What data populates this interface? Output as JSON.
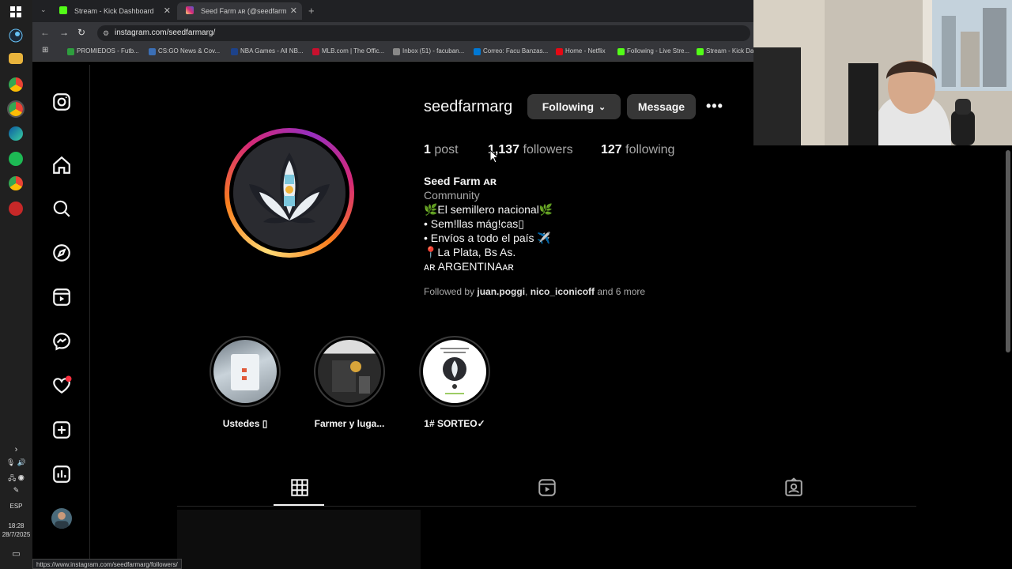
{
  "taskbar": {
    "time": "18:28",
    "date": "28/7/2025",
    "lang": "ESP"
  },
  "browser": {
    "tabs": [
      {
        "label": "Stream - Kick Dashboard",
        "color": "#53fc18"
      },
      {
        "label": "Seed Farm ᴀʀ (@seedfarmarg) ·",
        "color": "#e1306c"
      }
    ],
    "url": "instagram.com/seedfarmarg/",
    "bookmarks": [
      {
        "label": "PROMIEDOS - Futb...",
        "color": "#2e9e3e"
      },
      {
        "label": "CS:GO News & Cov...",
        "color": "#3b6fb6"
      },
      {
        "label": "NBA Games - All NB...",
        "color": "#1d428a"
      },
      {
        "label": "MLB.com | The Offic...",
        "color": "#c8102e"
      },
      {
        "label": "Inbox (51) - facuban...",
        "color": "#888888"
      },
      {
        "label": "Correo: Facu Banzas...",
        "color": "#0078d4"
      },
      {
        "label": "Home - Netflix",
        "color": "#e50914"
      },
      {
        "label": "Following - Live Stre...",
        "color": "#53fc18"
      },
      {
        "label": "Stream - Kick Da",
        "color": "#53fc18"
      }
    ],
    "status_url": "https://www.instagram.com/seedfarmarg/followers/"
  },
  "profile": {
    "username": "seedfarmarg",
    "following_btn": "Following",
    "message_btn": "Message",
    "posts_count": "1",
    "posts_label": "post",
    "followers_count": "1,137",
    "followers_label": "followers",
    "following_count": "127",
    "following_label": "following",
    "display_name": "Seed Farm ᴀʀ",
    "category": "Community",
    "bio_lines": [
      "🌿El semillero nacional🌿",
      "• Sem!llas mág!cas▯",
      "• Envíos a todo el país ✈️",
      "📍La Plata, Bs As.",
      "ᴀʀ ARGENTINAᴀʀ"
    ],
    "followed_by_prefix": "Followed by",
    "followed_by_user1": "juan.poggi",
    "followed_by_user2": "nico_iconicoff",
    "followed_by_suffix": "and 6 more"
  },
  "highlights": [
    {
      "label": "Ustedes ▯"
    },
    {
      "label": "Farmer y luga..."
    },
    {
      "label": "1# SORTEO✓"
    }
  ],
  "colors": {
    "accent_red": "#ff3040",
    "button_bg": "#363636"
  }
}
